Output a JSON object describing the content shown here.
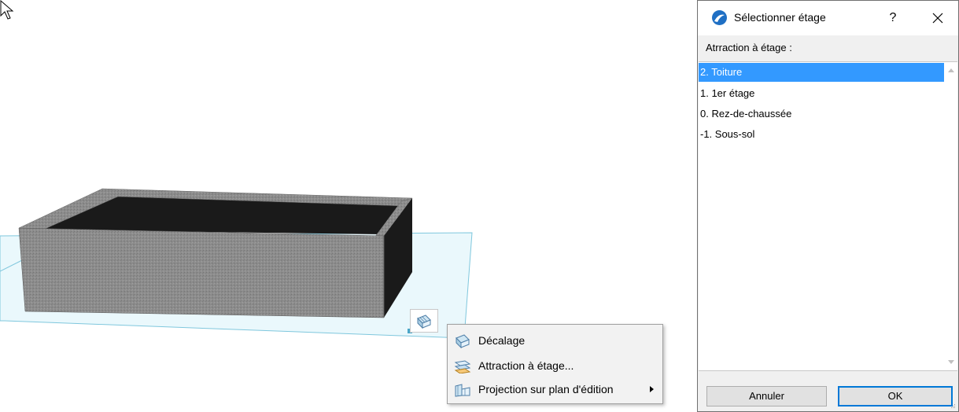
{
  "dialog": {
    "title": "Sélectionner étage",
    "help_label": "?",
    "section_label": "Atrraction à étage :",
    "stories": [
      {
        "label": "2. Toiture",
        "selected": true
      },
      {
        "label": "1. 1er étage",
        "selected": false
      },
      {
        "label": "0. Rez-de-chaussée",
        "selected": false
      },
      {
        "label": "-1. Sous-sol",
        "selected": false
      }
    ],
    "cancel_label": "Annuler",
    "ok_label": "OK"
  },
  "context_menu": {
    "items": [
      {
        "label": "Décalage",
        "icon": "offset-icon",
        "has_submenu": false
      },
      {
        "label": "Attraction à étage...",
        "icon": "snap-to-story-icon",
        "has_submenu": false
      },
      {
        "label": "Projection sur plan d'édition",
        "icon": "projection-icon",
        "has_submenu": true
      }
    ]
  },
  "colors": {
    "selection": "#3399ff",
    "ok_border": "#0078d7",
    "edit_plane": "#eaf8fc",
    "wall_outer": "#8a8a8a",
    "wall_inner": "#1e1e1e"
  }
}
